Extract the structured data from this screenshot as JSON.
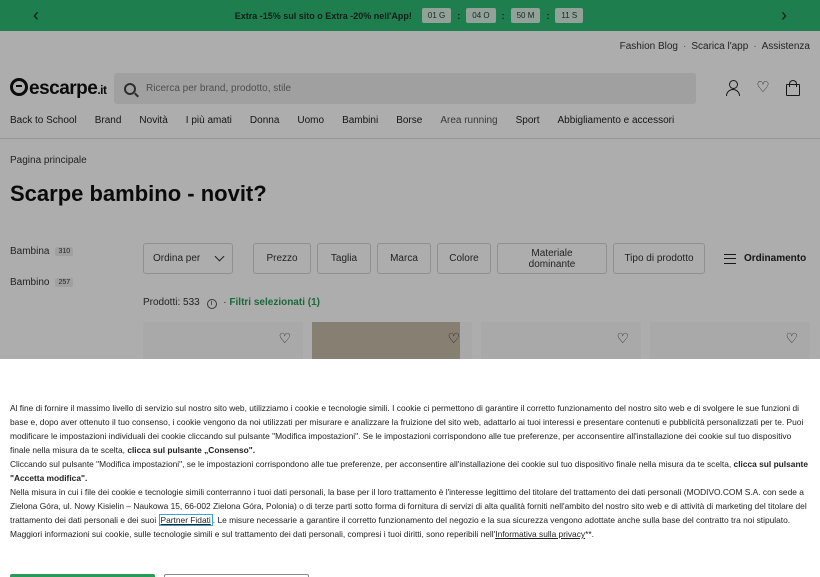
{
  "promo": {
    "text": "Extra -15% sul sito o Extra -20% nell'App!",
    "timer": [
      "01 G",
      "04 O",
      "50 M",
      "11 S"
    ],
    "separator": ":"
  },
  "util_links": [
    "Fashion Blog",
    "Scarica l'app",
    "Assistenza"
  ],
  "util_separator": "·",
  "header": {
    "logo": "escarpe",
    "logo_tld": ".it",
    "search_placeholder": "Ricerca per brand, prodotto, stile"
  },
  "nav": [
    "Back to School",
    "Brand",
    "Novità",
    "I più amati",
    "Donna",
    "Uomo",
    "Bambini",
    "Borse",
    "Area running",
    "Sport",
    "Abbigliamento e accessori"
  ],
  "breadcrumb": "Pagina principale",
  "page_title": "Scarpe bambino - novit?",
  "sidebar": [
    {
      "label": "Bambina",
      "count": "310"
    },
    {
      "label": "Bambino",
      "count": "257"
    }
  ],
  "filters": {
    "sort_label": "Ordina per",
    "items": [
      "Prezzo",
      "Taglia",
      "Marca",
      "Colore",
      "Materiale dominante",
      "Tipo di prodotto"
    ],
    "ordinamento": "Ordinamento"
  },
  "products": {
    "label": "Prodotti: 533",
    "info": "i",
    "separator": "·",
    "selected": "Filtri selezionati (1)"
  },
  "cookie": {
    "p1": "Al fine di fornire il massimo livello di servizio sul nostro sito web, utilizziamo i cookie e tecnologie simili. I cookie ci permettono di garantire il corretto funzionamento del nostro sito web e di svolgere le sue funzioni di base e, dopo aver ottenuto il tuo consenso, i cookie vengono da noi utilizzati per misurare e analizzare la fruizione del sito web, adattarlo ai tuoi interessi e presentare contenuti e pubblicità personalizzati per te. Puoi modificare le impostazioni individuali dei cookie cliccando sul pulsante \"Modifica impostazioni\". Se le impostazioni corrispondono alle tue preferenze, per acconsentire all'installazione dei cookie sul tuo dispositivo finale nella misura da te scelta, ",
    "p1_bold": "clicca sul pulsante „Consenso\".",
    "p2": "Cliccando sul pulsante \"Modifica impostazioni\", se le impostazioni corrispondono alle tue preferenze, per acconsentire all'installazione dei cookie sul tuo dispositivo finale nella misura da te scelta, ",
    "p2_bold": "clicca sul pulsante \"Accetta modifica\".",
    "p3_a": "Nella misura in cui i file dei cookie e tecnologie simili conterranno i tuoi dati personali, la base per il loro trattamento è l'interesse legittimo del titolare del trattamento dei dati personali (MODIVO.COM S.A. con sede a Zielona Góra, ul. Nowy Kisielin – Naukowa 15, 66-002 Zielona Góra, Polonia) o di terze parti sotto forma di fornitura di servizi di alta qualità forniti nell'ambito del nostro sito web e di attività di marketing del titolare del trattamento dei dati personali e dei suoi ",
    "partner_link": "Partner Fidati",
    "p3_b": ". Le misure necessarie a garantire il corretto funzionamento del negozio e la sua sicurezza vengono adottate anche sulla base del contratto tra noi stipulato. Maggiori informazioni sui cookie, sulle tecnologie simili e sul trattamento dei dati personali, compresi i tuoi diritti, sono reperibili nell'",
    "privacy_link": "Informativa sulla privacy",
    "p3_end": "**."
  }
}
